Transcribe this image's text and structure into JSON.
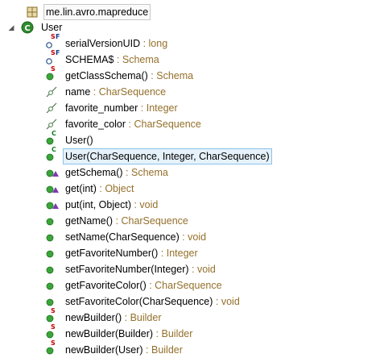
{
  "package": {
    "label": "me.lin.avro.mapreduce",
    "icon": "package-icon"
  },
  "class": {
    "label": "User",
    "icon": "class-icon",
    "expanded": true
  },
  "members": [
    {
      "label": "serialVersionUID",
      "type": "long",
      "icon": "static-final-field-icon"
    },
    {
      "label": "SCHEMA$",
      "type": "Schema",
      "icon": "static-final-field-icon"
    },
    {
      "label": "getClassSchema()",
      "type": "Schema",
      "icon": "public-static-method-icon"
    },
    {
      "label": "name",
      "type": "CharSequence",
      "icon": "deprecated-field-icon"
    },
    {
      "label": "favorite_number",
      "type": "Integer",
      "icon": "deprecated-field-icon"
    },
    {
      "label": "favorite_color",
      "type": "CharSequence",
      "icon": "deprecated-field-icon"
    },
    {
      "label": "User()",
      "type": "",
      "icon": "constructor-icon"
    },
    {
      "label": "User(CharSequence, Integer, CharSequence)",
      "type": "",
      "icon": "constructor-icon",
      "selected": true
    },
    {
      "label": "getSchema()",
      "type": "Schema",
      "icon": "override-method-icon"
    },
    {
      "label": "get(int)",
      "type": "Object",
      "icon": "override-method-icon"
    },
    {
      "label": "put(int, Object)",
      "type": "void",
      "icon": "override-method-icon"
    },
    {
      "label": "getName()",
      "type": "CharSequence",
      "icon": "public-method-icon"
    },
    {
      "label": "setName(CharSequence)",
      "type": "void",
      "icon": "public-method-icon"
    },
    {
      "label": "getFavoriteNumber()",
      "type": "Integer",
      "icon": "public-method-icon"
    },
    {
      "label": "setFavoriteNumber(Integer)",
      "type": "void",
      "icon": "public-method-icon"
    },
    {
      "label": "getFavoriteColor()",
      "type": "CharSequence",
      "icon": "public-method-icon"
    },
    {
      "label": "setFavoriteColor(CharSequence)",
      "type": "void",
      "icon": "public-method-icon"
    },
    {
      "label": "newBuilder()",
      "type": "Builder",
      "icon": "public-static-method-icon"
    },
    {
      "label": "newBuilder(Builder)",
      "type": "Builder",
      "icon": "public-static-method-icon"
    },
    {
      "label": "newBuilder(User)",
      "type": "Builder",
      "icon": "public-static-method-icon"
    }
  ],
  "colors": {
    "type_text": "#94702b",
    "method_green": "#3aa63a",
    "selection_bg": "#e6f2fb",
    "selection_border": "#8ec1e8"
  }
}
